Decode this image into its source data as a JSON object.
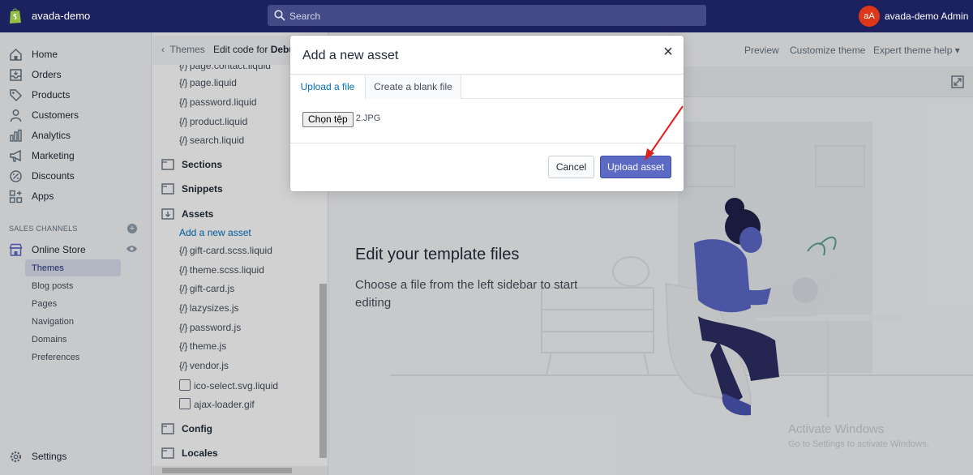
{
  "topbar": {
    "store_name": "avada-demo",
    "search_placeholder": "Search",
    "avatar_initials": "aA",
    "admin_name": "avada-demo Admin"
  },
  "nav": {
    "items": [
      {
        "label": "Home",
        "icon": "home-icon"
      },
      {
        "label": "Orders",
        "icon": "orders-icon"
      },
      {
        "label": "Products",
        "icon": "tag-icon"
      },
      {
        "label": "Customers",
        "icon": "person-icon"
      },
      {
        "label": "Analytics",
        "icon": "bar-chart-icon"
      },
      {
        "label": "Marketing",
        "icon": "megaphone-icon"
      },
      {
        "label": "Discounts",
        "icon": "discount-icon"
      },
      {
        "label": "Apps",
        "icon": "apps-icon"
      }
    ],
    "channels_heading": "SALES CHANNELS",
    "online_store": "Online Store",
    "sub_items": [
      "Themes",
      "Blog posts",
      "Pages",
      "Navigation",
      "Domains",
      "Preferences"
    ],
    "settings": "Settings"
  },
  "editor": {
    "back_label": "Themes",
    "edit_code_prefix": "Edit code for ",
    "edit_code_theme": "Debu",
    "preview": "Preview",
    "customize": "Customize theme",
    "expert_help": "Expert theme help"
  },
  "tree": {
    "partial_file": "page.contact.liquid",
    "template_files": [
      "page.liquid",
      "password.liquid",
      "product.liquid",
      "search.liquid"
    ],
    "folders": {
      "sections": "Sections",
      "snippets": "Snippets",
      "assets": "Assets",
      "config": "Config",
      "locales": "Locales"
    },
    "add_asset_link": "Add a new asset",
    "asset_files": [
      "gift-card.scss.liquid",
      "theme.scss.liquid",
      "gift-card.js",
      "lazysizes.js",
      "password.js",
      "theme.js",
      "vendor.js"
    ],
    "image_files": [
      "ico-select.svg.liquid",
      "ajax-loader.gif"
    ],
    "code_glyph": "{/}"
  },
  "main": {
    "empty_title": "Edit your template files",
    "empty_body": "Choose a file from the left sidebar to start editing",
    "watermark_title": "Activate Windows",
    "watermark_body": "Go to Settings to activate Windows."
  },
  "modal": {
    "title": "Add a new asset",
    "close": "×",
    "tab_upload": "Upload a file",
    "tab_blank": "Create a blank file",
    "choose_file": "Chọn tệp",
    "file_name": "2.JPG",
    "cancel": "Cancel",
    "upload": "Upload asset"
  },
  "colors": {
    "topbar": "#1c2260",
    "primary_button": "#5c6ac4",
    "link": "#006fbb",
    "annotation_arrow": "#e0201b"
  }
}
